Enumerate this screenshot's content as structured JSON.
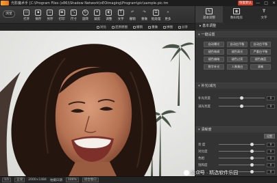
{
  "titlebar": {
    "app_name": "光影魔术手",
    "path": "[C:\\Program Files (x86)\\Shadow Network\\nEOimaging\\Program\\pic\\sample.pic.tm",
    "rec_badge": "恢复默认",
    "win_controls": [
      "—",
      "□",
      "✕"
    ]
  },
  "toolbar": {
    "menu_label": "浏览",
    "tools": [
      {
        "label": "打开",
        "icon": "open-folder-icon"
      },
      {
        "label": "保存",
        "icon": "save-icon"
      },
      {
        "label": "另存",
        "icon": "save-as-icon"
      },
      {
        "label": "打印",
        "icon": "print-icon"
      },
      {
        "label": "尺寸",
        "icon": "resize-icon"
      },
      {
        "label": "旋转",
        "icon": "rotate-icon"
      },
      {
        "label": "裁剪",
        "icon": "crop-icon"
      },
      {
        "label": "调整",
        "icon": "adjust-icon"
      },
      {
        "label": "文字",
        "icon": "text-icon"
      },
      {
        "label": "撤销",
        "icon": "undo-icon"
      },
      {
        "label": "重做",
        "icon": "redo-icon"
      },
      {
        "label": "批处理",
        "icon": "batch-icon"
      },
      {
        "label": "更多",
        "icon": "more-icon"
      }
    ]
  },
  "subbar": {
    "items": [
      "对比",
      "还原原图",
      "撤销",
      "重做",
      "拼图",
      "分享"
    ]
  },
  "rpanel": {
    "tabs": [
      {
        "label": "基本调整",
        "icon": "adjust-panel-icon",
        "active": true
      },
      {
        "label": "数码暗房",
        "icon": "camera-icon",
        "active": false
      },
      {
        "label": "文字",
        "icon": "text-panel-icon",
        "active": false
      }
    ],
    "basic_header": "基本调整",
    "sections": {
      "one_key": "一键设置",
      "tone": "补光/减光",
      "sharpen": "清晰度"
    },
    "presets": [
      "自动曝光",
      "自动白平衡",
      "自动白平衡",
      "褪色暗调",
      "褪色高光",
      "严重白平衡",
      "褪色偏暗",
      "褪色过亮",
      "褪色偏蓝",
      "数字补光",
      "人像美白",
      "清晰"
    ],
    "tone_sliders": [
      {
        "label": "补光亮度",
        "value": "0",
        "level": 0.5
      },
      {
        "label": "减光亮度",
        "value": "0",
        "level": 0.5
      }
    ],
    "adjust_sliders": [
      {
        "label": "亮 度",
        "value": "0",
        "level": 0.72
      },
      {
        "label": "对比度",
        "value": "0",
        "level": 0.72
      },
      {
        "label": "色相",
        "value": "0",
        "level": 0.72
      },
      {
        "label": "饱和度",
        "value": "0",
        "level": 0.72
      },
      {
        "label": "伽马",
        "value": "0",
        "level": 0.72
      }
    ],
    "reset_label": "设置"
  },
  "statusbar": {
    "items": [
      "1/1",
      "正常",
      "2000×1484",
      "拍摄日期",
      "100%",
      "适合窗口"
    ]
  },
  "watermark": "公众号 · 精选软件乐园"
}
